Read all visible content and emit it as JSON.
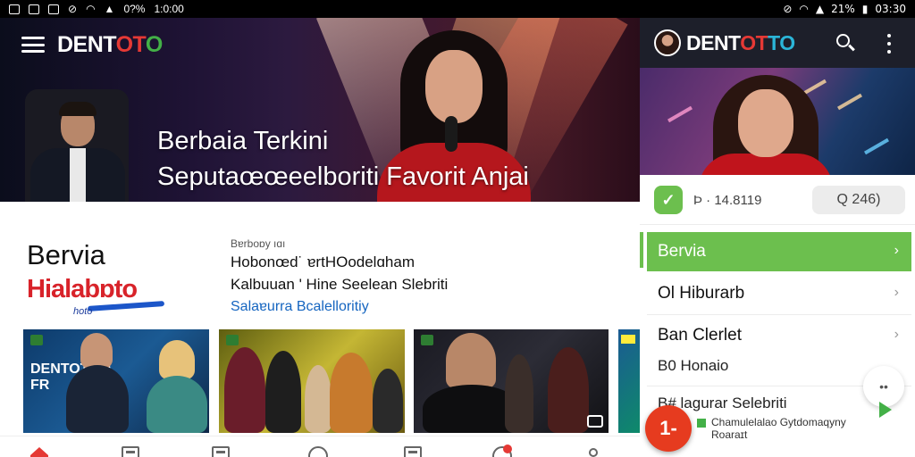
{
  "status_bar": {
    "left_signal": "0?%",
    "left_time": "1:0:00",
    "right_battery": "21%",
    "right_time": "03:30"
  },
  "left_app": {
    "logo": {
      "part1": "DENT",
      "part2": "OT",
      "part3": "O"
    },
    "hero_title_line1": "Berbaia Terkini",
    "hero_title_line2": "Seputaœœeelboriti Favorit Anjai",
    "section": {
      "title": "Bervia",
      "brand": "Hialabɒto",
      "brand_tag": "hoto",
      "meta": "Bɐrboɒy ıɑı",
      "line1": "Hobonœd˙ ɐrtHOodelɑham",
      "line2": "Kalbuuan ' Hine Seelean Slebriti",
      "link": "Salaɐurra Bcalelloritiy"
    },
    "thumbs": [
      {
        "text": "DENTOTOO\nFR"
      },
      {
        "text": ""
      },
      {
        "text": ""
      },
      {
        "text": ""
      }
    ],
    "tabs": [
      "home",
      "share",
      "save",
      "lock",
      "folder",
      "favorite",
      "profile"
    ]
  },
  "right_app": {
    "logo": {
      "part1": "DENT",
      "part2": "OT",
      "part3": "TO"
    },
    "stat_text": "Þ · 14.8119",
    "search_pill": "Q  246)",
    "menu": [
      {
        "label": "Bervia",
        "active": true
      },
      {
        "label": "Ol Hiburarb",
        "active": false
      },
      {
        "label": "Ban Clerlet",
        "active": false
      }
    ],
    "sub_label": "B0  Honaio",
    "item4_label": "B# lagurar Selebriti",
    "foot_line1": "Chamulelalao Gytdomaqyny",
    "foot_line2": "Roaraɪt",
    "fab_label": "1-",
    "more_label": "••"
  },
  "colors": {
    "brand_red": "#e53935",
    "brand_green": "#43b047",
    "active_green": "#6cbf4e",
    "header_dark": "#1d1f2a"
  }
}
